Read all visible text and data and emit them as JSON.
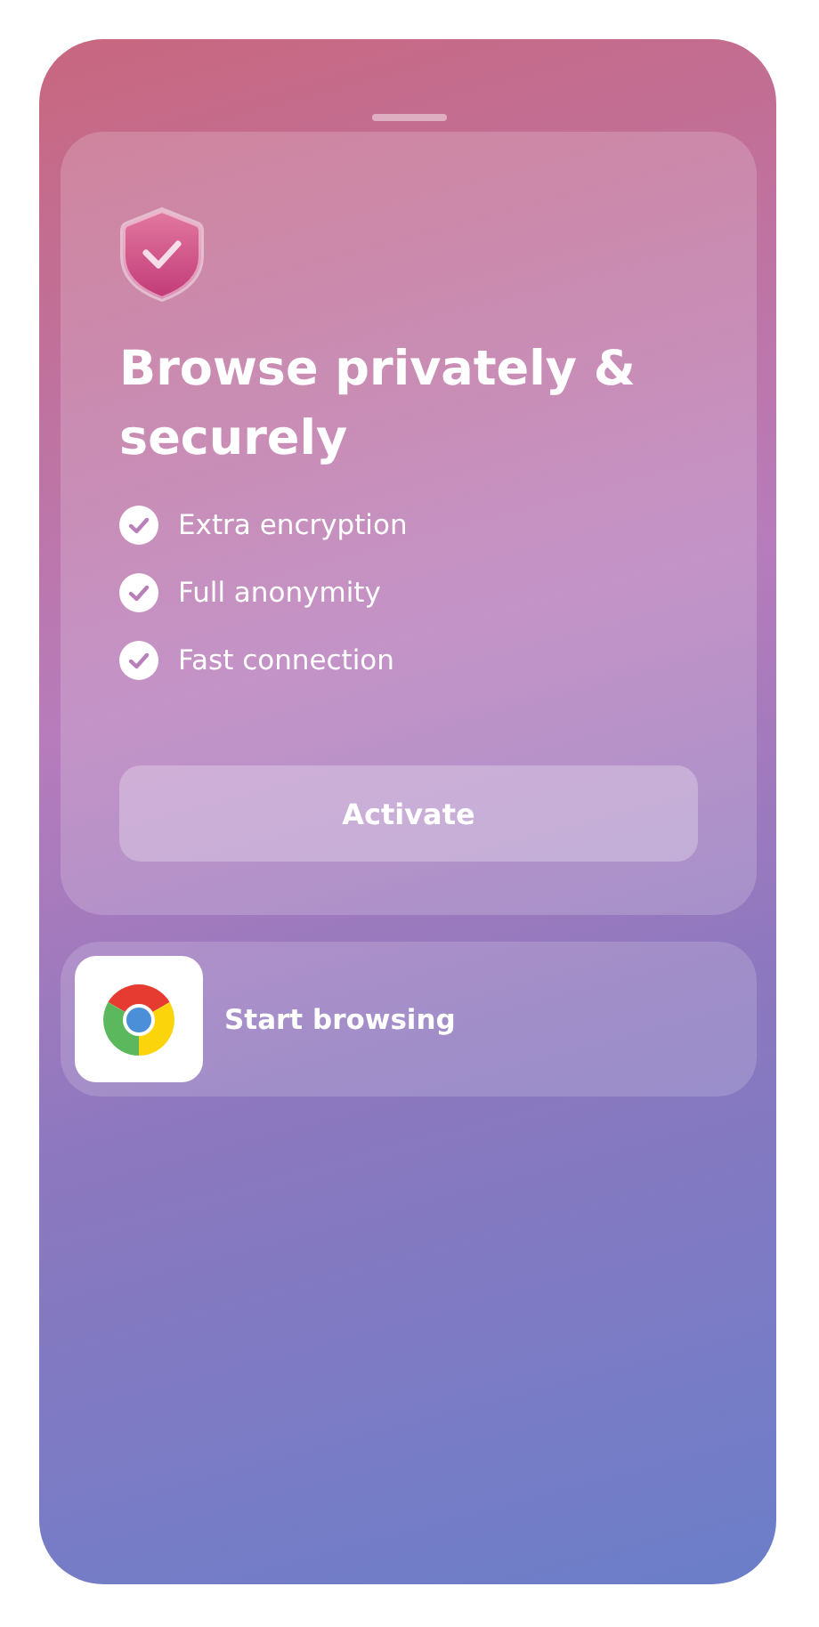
{
  "promo_card": {
    "title": "Browse privately & securely",
    "features": [
      "Extra encryption",
      "Full anonymity",
      "Fast connection"
    ],
    "button": "Activate"
  },
  "browser_card": {
    "label": "Start browsing"
  }
}
